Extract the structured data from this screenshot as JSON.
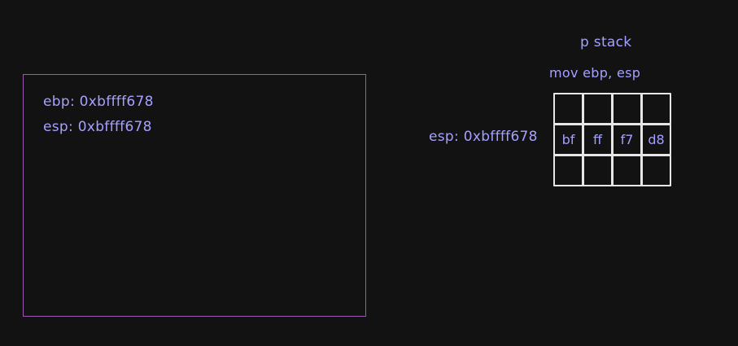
{
  "colors": {
    "background": "#121212",
    "text": "#a5a1ff",
    "box_border": "#9b59b6",
    "grid_line": "#e6e6e6"
  },
  "stack": {
    "title": "p stack",
    "instruction": "mov ebp, esp",
    "esp_label": "esp: 0xbffff678",
    "rows": [
      [
        "",
        "",
        "",
        ""
      ],
      [
        "bf",
        "ff",
        "f7",
        "d8"
      ],
      [
        "",
        "",
        "",
        ""
      ]
    ]
  },
  "registers": {
    "ebp": "ebp: 0xbffff678",
    "esp": "esp: 0xbffff678"
  }
}
